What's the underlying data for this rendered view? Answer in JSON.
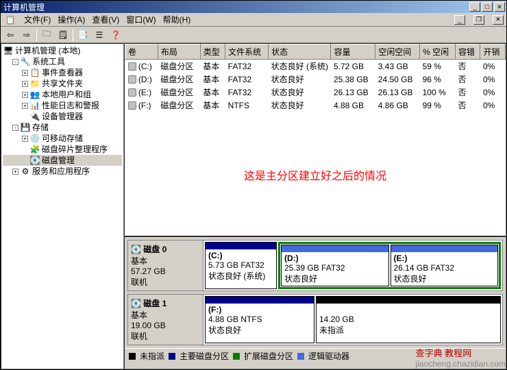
{
  "window": {
    "title": "计算机管理"
  },
  "menu": {
    "file": "文件(F)",
    "action": "操作(A)",
    "view": "查看(V)",
    "window": "窗口(W)",
    "help": "帮助(H)"
  },
  "tree": {
    "root": "计算机管理 (本地)",
    "systools": "系统工具",
    "eventviewer": "事件查看器",
    "shared": "共享文件夹",
    "localusers": "本地用户和组",
    "perflogs": "性能日志和警报",
    "devmgr": "设备管理器",
    "storage": "存储",
    "removable": "可移动存储",
    "defrag": "磁盘碎片整理程序",
    "diskmgmt": "磁盘管理",
    "services": "服务和应用程序"
  },
  "cols": {
    "vol": "卷",
    "layout": "布局",
    "type": "类型",
    "fs": "文件系统",
    "status": "状态",
    "capacity": "容量",
    "free": "空闲空间",
    "pctfree": "% 空闲",
    "fault": "容错",
    "overhead": "开销"
  },
  "rows": [
    {
      "v": "(C:)",
      "l": "磁盘分区",
      "t": "基本",
      "fs": "FAT32",
      "s": "状态良好 (系统)",
      "c": "5.72 GB",
      "f": "3.43 GB",
      "p": "59 %",
      "ft": "否",
      "o": "0%"
    },
    {
      "v": "(D:)",
      "l": "磁盘分区",
      "t": "基本",
      "fs": "FAT32",
      "s": "状态良好",
      "c": "25.38 GB",
      "f": "24.50 GB",
      "p": "96 %",
      "ft": "否",
      "o": "0%"
    },
    {
      "v": "(E:)",
      "l": "磁盘分区",
      "t": "基本",
      "fs": "FAT32",
      "s": "状态良好",
      "c": "26.13 GB",
      "f": "26.13 GB",
      "p": "100 %",
      "ft": "否",
      "o": "0%"
    },
    {
      "v": "(F:)",
      "l": "磁盘分区",
      "t": "基本",
      "fs": "NTFS",
      "s": "状态良好",
      "c": "4.88 GB",
      "f": "4.86 GB",
      "p": "99 %",
      "ft": "否",
      "o": "0%"
    }
  ],
  "annotation": "这是主分区建立好之后的情况",
  "disk0": {
    "title": "磁盘 0",
    "type": "基本",
    "size": "57.27 GB",
    "state": "联机",
    "p1": {
      "label": "(C:)",
      "info": "5.73 GB FAT32",
      "status": "状态良好 (系统)"
    },
    "p2": {
      "label": "(D:)",
      "info": "25.39 GB FAT32",
      "status": "状态良好"
    },
    "p3": {
      "label": "(E:)",
      "info": "26.14 GB FAT32",
      "status": "状态良好"
    }
  },
  "disk1": {
    "title": "磁盘 1",
    "type": "基本",
    "size": "19.00 GB",
    "state": "联机",
    "p1": {
      "label": "(F:)",
      "info": "4.88 GB NTFS",
      "status": "状态良好"
    },
    "p2": {
      "info": "14.20 GB",
      "status": "未指派"
    }
  },
  "legend": {
    "un": "未指派",
    "pri": "主要磁盘分区",
    "ext": "扩展磁盘分区",
    "log": "逻辑驱动器"
  },
  "colors": {
    "unalloc": "#000",
    "primary": "#00008b",
    "extended": "#008000",
    "logical": "#4169e1"
  },
  "footer1": "查字典 教程网",
  "footer2": "jiaocheng.chazidian.com"
}
